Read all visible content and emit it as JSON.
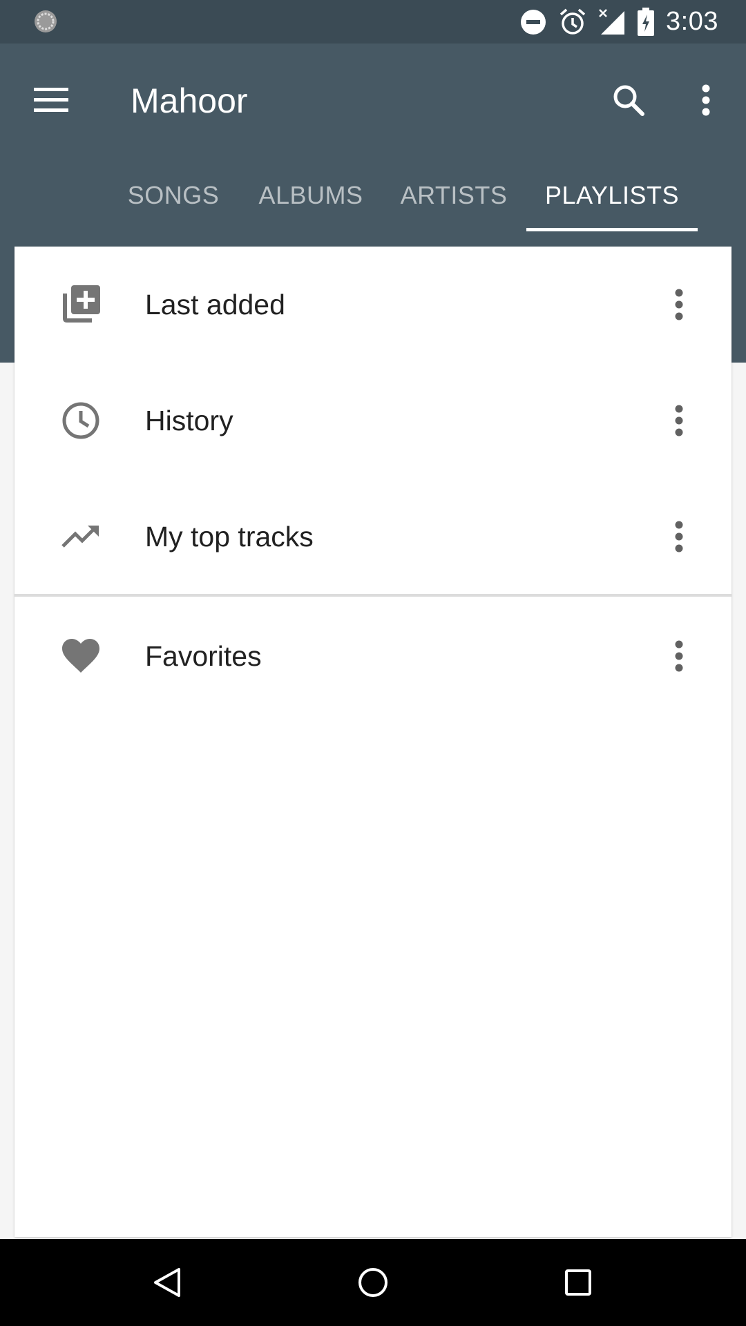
{
  "status_bar": {
    "time": "3:03",
    "left_icon": "sync-icon",
    "right_icons": [
      "do-not-disturb-icon",
      "alarm-icon",
      "signal-no-data-icon",
      "battery-charging-icon"
    ]
  },
  "app_bar": {
    "title": "Mahoor",
    "menu_icon": "menu-icon",
    "search_icon": "search-icon",
    "overflow_icon": "more-vert-icon",
    "color": "#475964"
  },
  "tabs": [
    {
      "label": "SONGS",
      "active": false
    },
    {
      "label": "ALBUMS",
      "active": false
    },
    {
      "label": "ARTISTS",
      "active": false
    },
    {
      "label": "PLAYLISTS",
      "active": true
    }
  ],
  "playlists": [
    {
      "label": "Last added",
      "icon": "library-add-icon"
    },
    {
      "label": "History",
      "icon": "clock-icon"
    },
    {
      "label": "My top tracks",
      "icon": "trending-up-icon"
    },
    {
      "label": "Favorites",
      "icon": "heart-icon"
    }
  ],
  "nav_bar": {
    "buttons": [
      "back-icon",
      "home-icon",
      "recents-icon"
    ]
  },
  "colors": {
    "status_bar": "#3b4b55",
    "app_bar": "#475964",
    "icon_gray": "#757575",
    "text_primary": "#212121"
  }
}
